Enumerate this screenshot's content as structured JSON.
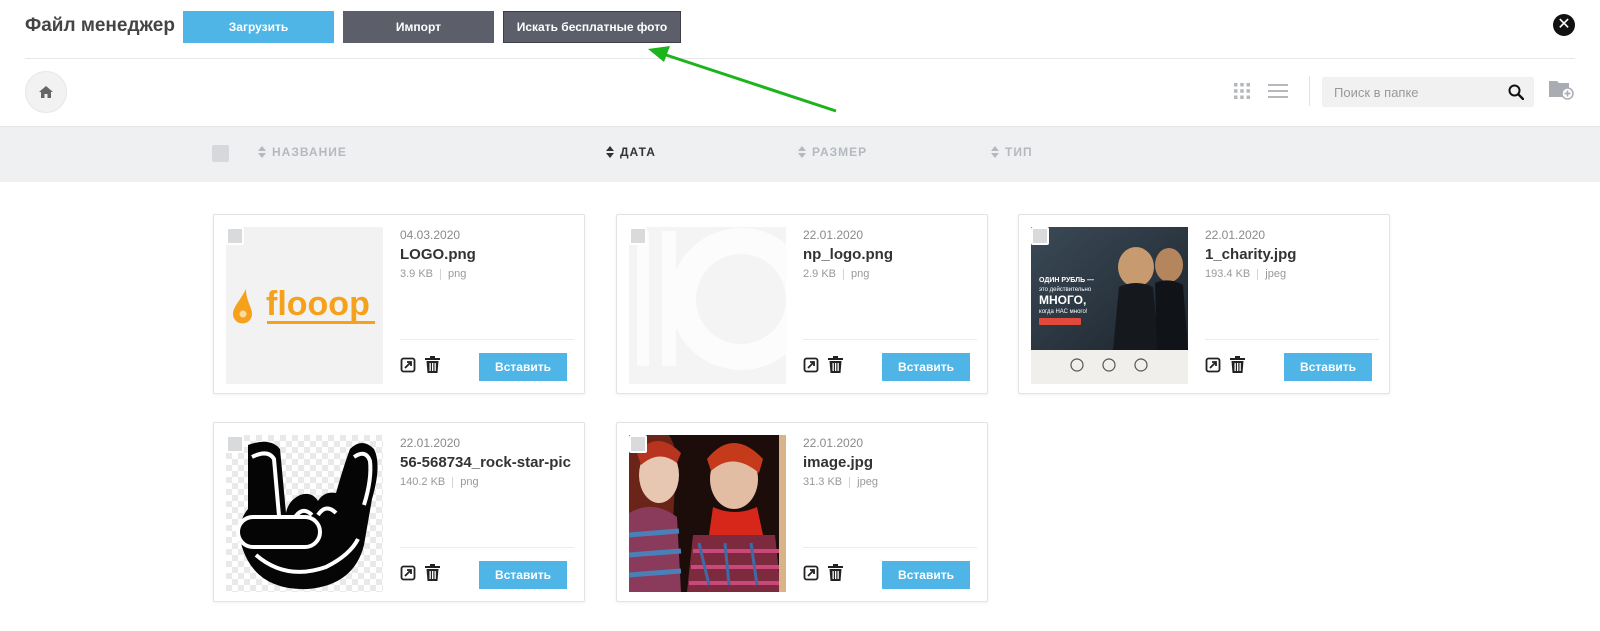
{
  "header": {
    "title": "Файл менеджер",
    "upload_label": "Загрузить",
    "import_label": "Импорт",
    "search_free_label": "Искать бесплатные фото",
    "close_icon": "close-icon"
  },
  "toolbar": {
    "search_placeholder": "Поиск в папке",
    "icons": [
      "home-icon",
      "grid-view-icon",
      "list-view-icon",
      "search-icon",
      "new-folder-icon"
    ]
  },
  "columns": {
    "name": "НАЗВАНИЕ",
    "date": "ДАТА",
    "size": "РАЗМЕР",
    "type": "ТИП",
    "active_sort": "date"
  },
  "files": [
    {
      "date": "04.03.2020",
      "name": "LOGO.png",
      "size": "3.9 KB",
      "type": "png",
      "insert_label": "Вставить",
      "logo_text": "flooop"
    },
    {
      "date": "22.01.2020",
      "name": "np_logo.png",
      "size": "2.9 KB",
      "type": "png",
      "insert_label": "Вставить"
    },
    {
      "date": "22.01.2020",
      "name": "1_charity.jpg",
      "size": "193.4 KB",
      "type": "jpeg",
      "insert_label": "Вставить",
      "thumb_text": [
        "ОДИН РУБЛЬ —",
        "это действительно",
        "МНОГО,",
        "когда НАС много!"
      ]
    },
    {
      "date": "22.01.2020",
      "name": "56-568734_rock-star-pic",
      "size": "140.2 KB",
      "type": "png",
      "insert_label": "Вставить"
    },
    {
      "date": "22.01.2020",
      "name": "image.jpg",
      "size": "31.3 KB",
      "type": "jpeg",
      "insert_label": "Вставить"
    }
  ],
  "colors": {
    "primary_blue": "#4eb5e6",
    "dark_button": "#5c5f6a",
    "arrow_green": "#1db31d",
    "band_bg": "#eef0f2"
  }
}
